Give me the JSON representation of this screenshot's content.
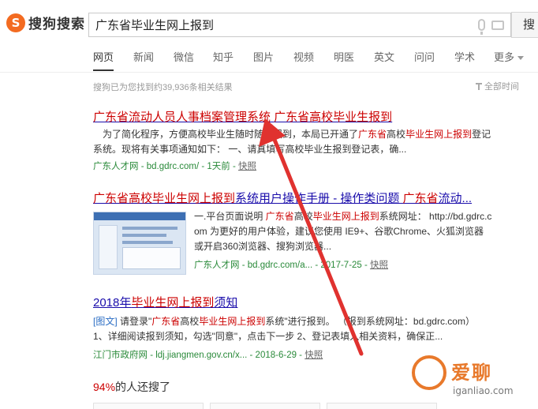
{
  "header": {
    "logo_mark": "S",
    "logo_text": "搜狗搜索",
    "query": "广东省毕业生网上报到",
    "search_button": "搜"
  },
  "tabs": [
    {
      "label": "网页",
      "active": true
    },
    {
      "label": "新闻"
    },
    {
      "label": "微信"
    },
    {
      "label": "知乎"
    },
    {
      "label": "图片"
    },
    {
      "label": "视频"
    },
    {
      "label": "明医"
    },
    {
      "label": "英文"
    },
    {
      "label": "问问"
    },
    {
      "label": "学术"
    },
    {
      "label": "更多"
    }
  ],
  "result_count": "搜狗已为您找到约39,936条相关结果",
  "time_filter": "全部时间",
  "results": [
    {
      "title_a": "广东省流动人员人事档案管理系统 ",
      "title_b": "广东省高校毕业生报到",
      "snippet_1a": "为了简化程序，方便高校毕业生随时随地报到，本局已开通了",
      "snippet_1b": "广东省",
      "snippet_1c": "高校",
      "snippet_1d": "毕业生网上报到",
      "snippet_1e": "登记",
      "snippet_2a": "系统。现将有关事项通知如下：    一、请",
      "snippet_2b": "真填写高校毕业生报到登记表，确...",
      "meta_source": "广东人才网 - bd.gdrc.com/ - 1天前 - ",
      "meta_snapshot": "快照"
    },
    {
      "title_a": "广东省高校毕业生网上报到",
      "title_b": "系统用户",
      "title_c": "操作手册 - 操作类问题 ",
      "title_d": "广东省",
      "title_e": "流动...",
      "snippet_1a": "一.平台页面说明 ",
      "snippet_1b": "广东省",
      "snippet_1c": "高校",
      "snippet_1d": "毕业生网上报到",
      "snippet_1e": "系统网址：  http://bd.gdrc.c",
      "snippet_2": "om 为更好的用户体验，建议您使用 IE9+、谷歌Chrome、火狐浏览器",
      "snippet_3": "或开启360浏览器、搜狗浏览器...",
      "meta_source": "广东人才网 - bd.gdrc.com/a... - 2017-7-25 - ",
      "meta_snapshot": "快照"
    },
    {
      "title_a": "2018年",
      "title_b": "毕业生网上报到",
      "title_c": "须知",
      "tag": "[图文]",
      "snippet_1a": " 请登录\"",
      "snippet_1b": "广东省",
      "snippet_1c": "高校",
      "snippet_1d": "毕业生网上报到",
      "snippet_1e": "系统\"进行报到。 （报到系统网址：bd.gdrc.com）",
      "snippet_2": "1、详细阅读报到须知，勾选\"同意\"，点击下一步 2、登记表填入相关资料，确保正...",
      "meta_source": "江门市政府网 - ldj.jiangmen.gov.cn/x... - 2018-6-29 - ",
      "meta_snapshot": "快照"
    }
  ],
  "also_searched": {
    "percent": "94%",
    "label": "的人还搜了"
  },
  "watermark": {
    "brand": "爱聊",
    "url": "iganliao.com"
  },
  "colors": {
    "title_link": "#1a0dab",
    "highlight": "#cc0000",
    "source_green": "#2a8a3a",
    "annotation_arrow": "#e0322f",
    "logo_orange": "#f36b21"
  }
}
